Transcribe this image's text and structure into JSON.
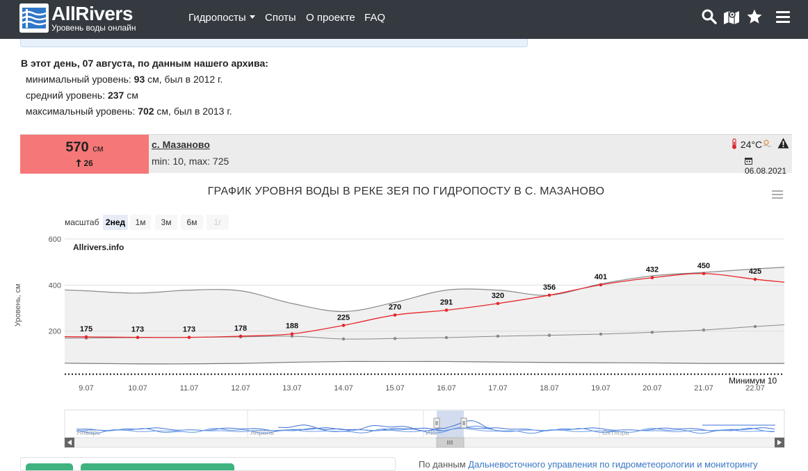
{
  "header": {
    "logo_title": "AllRivers",
    "logo_subtitle": "Уровень воды онлайн",
    "menu": [
      {
        "label": "Гидропосты",
        "dropdown": true
      },
      {
        "label": "Споты"
      },
      {
        "label": "О проекте"
      },
      {
        "label": "FAQ"
      }
    ],
    "icons": [
      "search-icon",
      "map-icon",
      "star-icon",
      "menu-icon"
    ],
    "bg_color": "#343a40"
  },
  "archive": {
    "heading": "В этот день, 07 августа, по данным нашего архива:",
    "min": {
      "prefix": "минимальный уровень: ",
      "value": "93",
      "suffix": " см, был в 2012 г."
    },
    "avg": {
      "prefix": "средний уровень: ",
      "value": "237",
      "suffix": " см"
    },
    "max": {
      "prefix": "максимальный уровень: ",
      "value": "702",
      "suffix": " см, был в 2013 г."
    }
  },
  "gauge": {
    "level_value": "570",
    "level_unit": "см",
    "level_delta": "26",
    "station": "с. Мазаново",
    "minmax": "min: 10, max: 725",
    "temperature": "24°C",
    "date": "06.08.2021",
    "level_color": "#f67777"
  },
  "chart": {
    "scale_label": "масштаб",
    "scale_buttons": [
      {
        "label": "2нед",
        "active": true
      },
      {
        "label": "1м"
      },
      {
        "label": "3м"
      },
      {
        "label": "6м"
      },
      {
        "label": "1г",
        "disabled": true
      }
    ],
    "watermark": "Allrivers.info",
    "min_label": "Минимум 10"
  },
  "chart_data": {
    "type": "line",
    "title": "ГРАФИК УРОВНЯ ВОДЫ В РЕКЕ ЗЕЯ ПО ГИДРОПОСТУ В С. МАЗАНОВО",
    "ylabel": "Уровень, см",
    "ylim": [
      0,
      600
    ],
    "yticks": [
      200,
      400,
      600
    ],
    "x": [
      "9.07",
      "10.07",
      "11.07",
      "12.07",
      "13.07",
      "14.07",
      "15.07",
      "16.07",
      "17.07",
      "18.07",
      "19.07",
      "20.07",
      "21.07",
      "22.07"
    ],
    "series": [
      {
        "role": "current",
        "color": "#e8242a",
        "values": [
          175,
          173,
          173,
          178,
          188,
          225,
          270,
          291,
          320,
          356,
          401,
          432,
          450,
          425
        ]
      },
      {
        "role": "average",
        "color": "#888888",
        "values": [
          170,
          172,
          173,
          175,
          178,
          166,
          168,
          172,
          178,
          182,
          187,
          195,
          205,
          220
        ]
      },
      {
        "role": "range-max",
        "color": "#888888",
        "values": [
          375,
          365,
          378,
          375,
          320,
          285,
          325,
          378,
          378,
          356,
          405,
          440,
          455,
          470
        ]
      },
      {
        "role": "range-min",
        "color": "#888888",
        "values": [
          60,
          58,
          58,
          60,
          65,
          68,
          68,
          68,
          66,
          64,
          63,
          62,
          60,
          60
        ]
      }
    ],
    "min_level": 10,
    "navigator_labels": [
      "Январь",
      "Апрель",
      "Июль",
      "Октябрь"
    ],
    "grid": true
  },
  "footer": {
    "prefix": "По данным ",
    "link": "Дальневосточного управления по гидрометеорологии и мониторингу"
  }
}
